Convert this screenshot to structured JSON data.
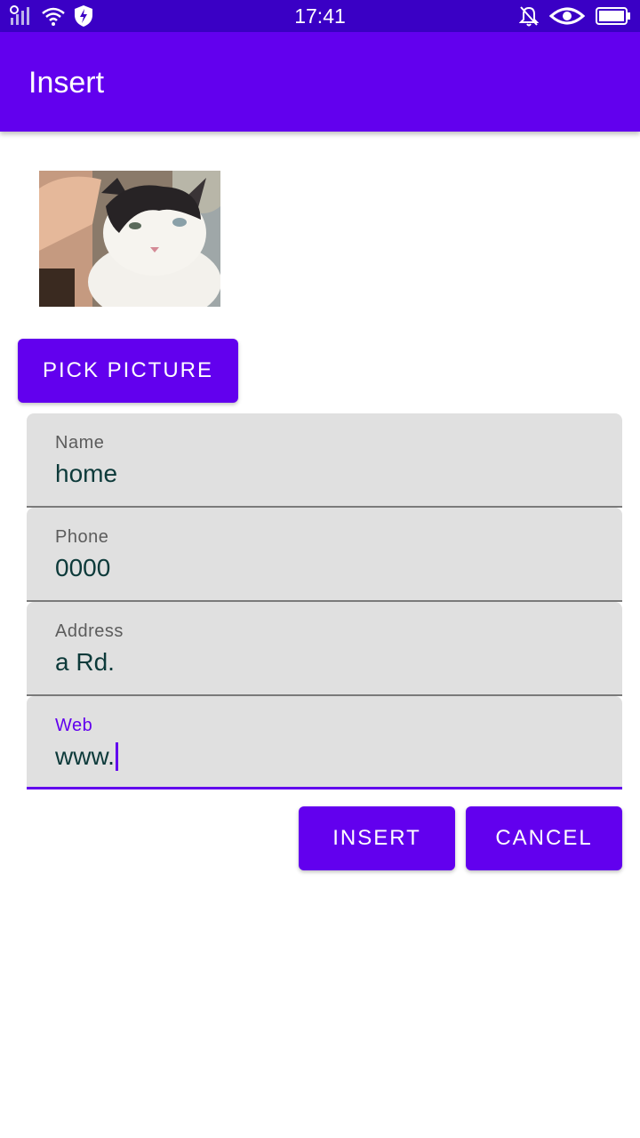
{
  "status_bar": {
    "time": "17:41",
    "icons_left": [
      "signal-icon",
      "wifi-icon",
      "shield-bolt-icon"
    ],
    "icons_right": [
      "bell-off-icon",
      "eye-icon",
      "battery-icon"
    ]
  },
  "app_bar": {
    "title": "Insert"
  },
  "photo": {
    "alt": "cat photo"
  },
  "pick_button": {
    "label": "PICK PICTURE"
  },
  "fields": [
    {
      "label": "Name",
      "value": "home"
    },
    {
      "label": "Phone",
      "value": "0000"
    },
    {
      "label": "Address",
      "value": "a Rd."
    },
    {
      "label": "Web",
      "value": "www."
    }
  ],
  "actions": {
    "insert_label": "INSERT",
    "cancel_label": "CANCEL"
  },
  "colors": {
    "primary": "#6200ee",
    "status_bar": "#3a00c5",
    "field_bg": "#e0e0e0"
  }
}
